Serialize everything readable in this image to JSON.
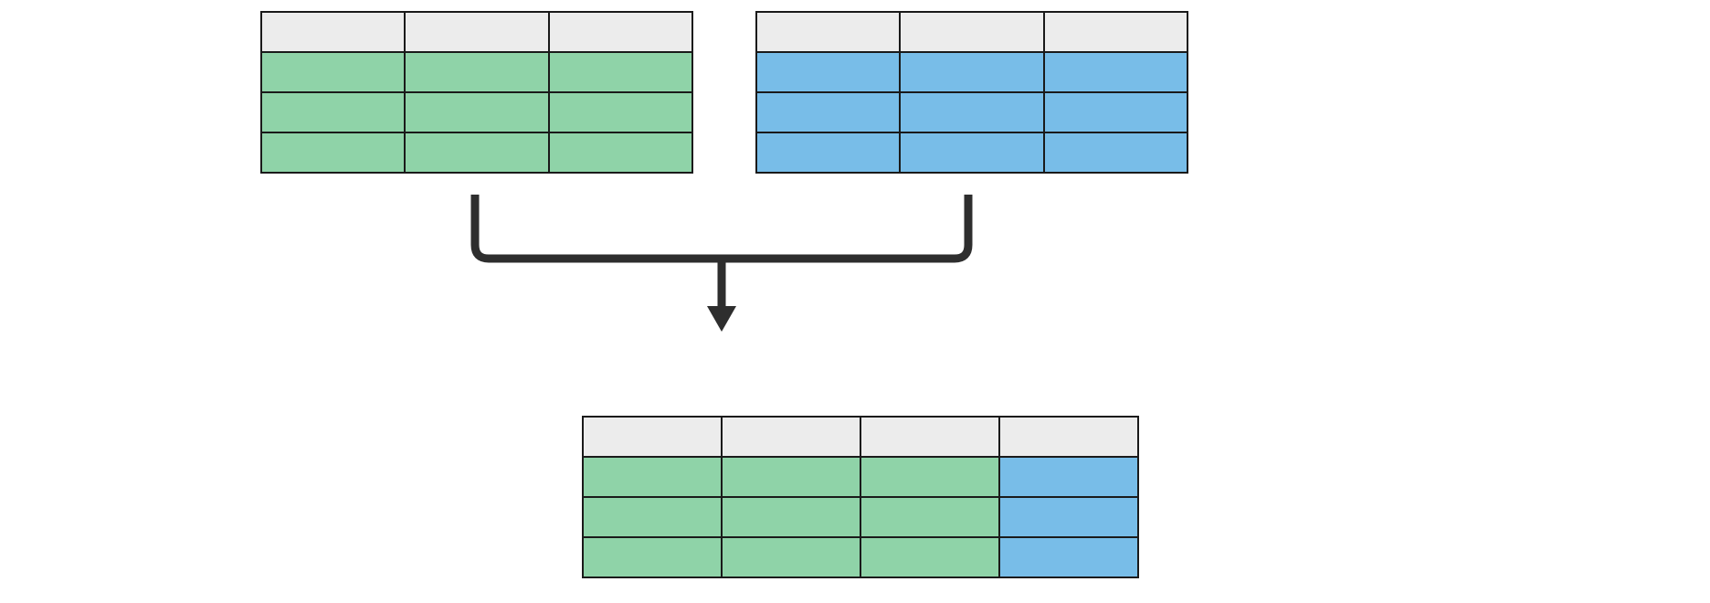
{
  "colors": {
    "header": "#ececec",
    "green": "#8fd3a8",
    "blue": "#78bde8",
    "border": "#1a1a1a",
    "arrow": "#2e2e2e"
  },
  "tables": {
    "top_left": {
      "cols": 3,
      "rows": 4,
      "row_colors": [
        "header",
        "green",
        "green",
        "green"
      ]
    },
    "top_right": {
      "cols": 3,
      "rows": 4,
      "row_colors": [
        "header",
        "blue",
        "blue",
        "blue"
      ]
    },
    "bottom": {
      "cols": 4,
      "rows": 4,
      "cell_colors": [
        [
          "header",
          "header",
          "header",
          "header"
        ],
        [
          "green",
          "green",
          "green",
          "blue"
        ],
        [
          "green",
          "green",
          "green",
          "blue"
        ],
        [
          "green",
          "green",
          "green",
          "blue"
        ]
      ]
    }
  }
}
